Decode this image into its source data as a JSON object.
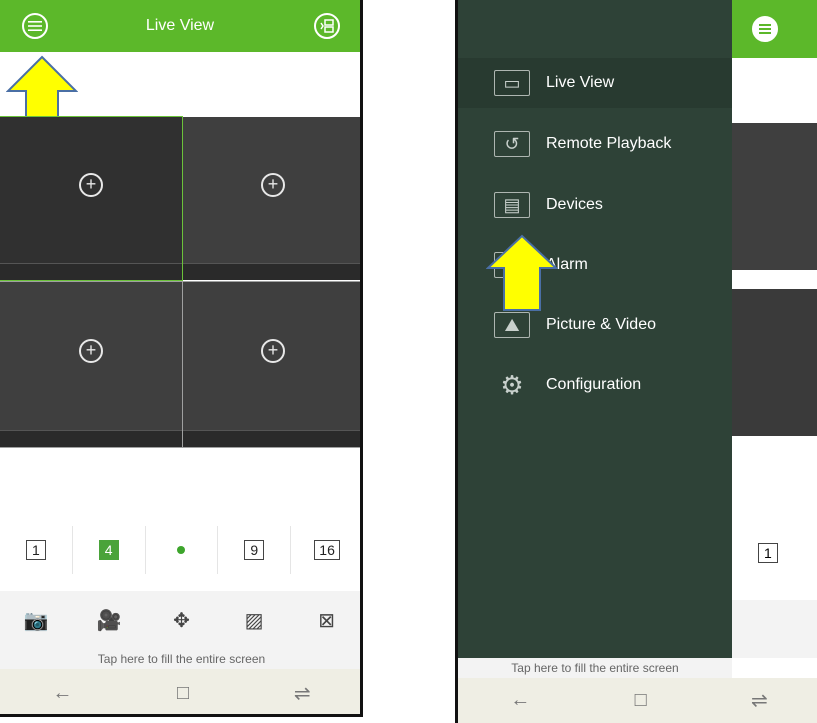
{
  "left": {
    "title": "Live View",
    "menu_icon": "hamburger-circle-icon",
    "layout_icon": "layout-switch-icon",
    "add_symbol": "+",
    "split_options": [
      "1",
      "4",
      "•",
      "9",
      "16"
    ],
    "tools": [
      {
        "icon": "camera-snapshot-icon",
        "glyph": "📷"
      },
      {
        "icon": "record-icon",
        "glyph": "🎥"
      },
      {
        "icon": "ptz-icon",
        "glyph": "✥"
      },
      {
        "icon": "image-quality-icon",
        "glyph": "▨"
      },
      {
        "icon": "close-all-icon",
        "glyph": "⊠"
      }
    ],
    "fill_hint": "Tap here to fill the entire screen",
    "nav": {
      "back": "←",
      "home": "□",
      "recent": "⇌"
    }
  },
  "right": {
    "menu": [
      {
        "label": "Live View",
        "icon": "camera-icon",
        "glyph": "▭"
      },
      {
        "label": "Remote Playback",
        "icon": "playback-icon",
        "glyph": "↺"
      },
      {
        "label": "Devices",
        "icon": "devices-icon",
        "glyph": "▤"
      },
      {
        "label": "Alarm",
        "icon": "alarm-icon",
        "glyph": "⚠"
      },
      {
        "label": "Picture & Video",
        "icon": "picture-icon",
        "glyph": "⛰"
      },
      {
        "label": "Configuration",
        "icon": "gear-icon",
        "glyph": "⚙"
      }
    ],
    "split_visible": "1",
    "fill_hint": "Tap here to fill the entire screen",
    "nav": {
      "back": "←",
      "home": "□",
      "recent": "⇌"
    }
  },
  "colors": {
    "green": "#5cb82a",
    "drawer": "#2e4237",
    "arrow": "#ffff00"
  }
}
